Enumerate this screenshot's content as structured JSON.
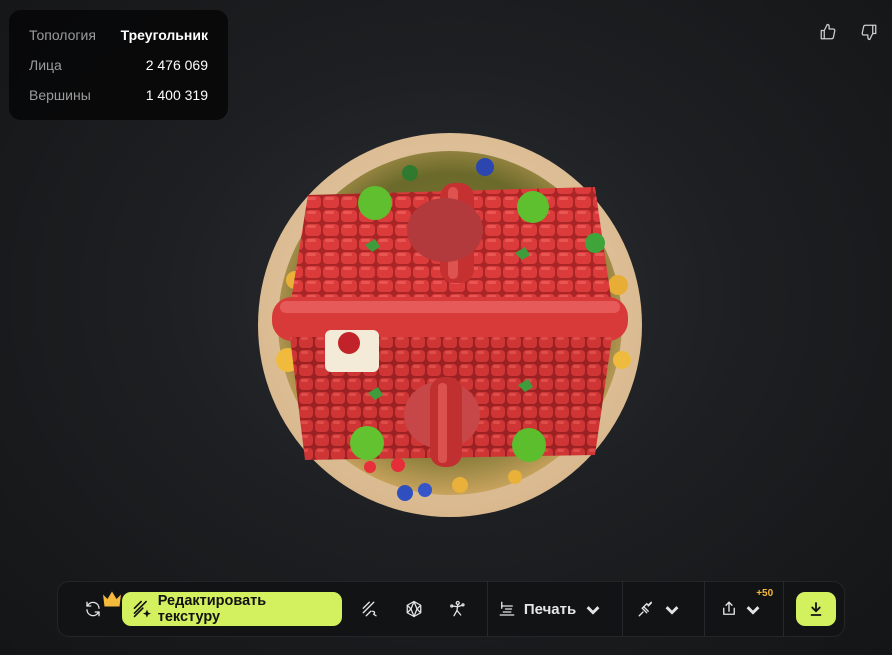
{
  "stats": {
    "rows": [
      {
        "label": "Топология",
        "value": "Треугольник"
      },
      {
        "label": "Лица",
        "value": "2 476 069"
      },
      {
        "label": "Вершины",
        "value": "1 400 319"
      }
    ]
  },
  "feedback": {
    "like_icon": "thumbs-up-icon",
    "dislike_icon": "thumbs-down-icon"
  },
  "toolbar": {
    "edit_texture_label": "Редактировать текстуру",
    "print_label": "Печать",
    "share_badge": "+50"
  },
  "colors": {
    "accent": "#d3f05f",
    "badge": "#f5b93b"
  }
}
